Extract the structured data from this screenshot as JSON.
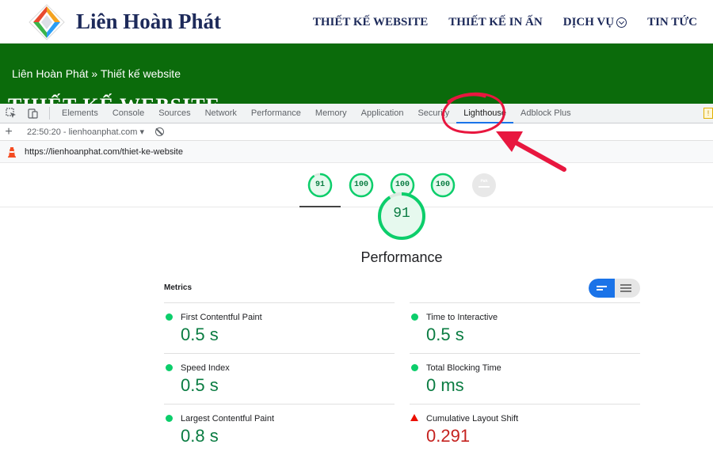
{
  "site": {
    "brand": "Liên Hoàn Phát",
    "nav": [
      {
        "label": "THIẾT KẾ WEBSITE"
      },
      {
        "label": "THIẾT KẾ IN ẤN"
      },
      {
        "label": "DỊCH VỤ",
        "icon": "chevron-down-circle-icon"
      },
      {
        "label": "TIN TỨC"
      }
    ],
    "breadcrumb": "Liên Hoàn Phát  »  Thiết kế website",
    "heading": "THIẾT KẾ WEBSITE",
    "banner_color": "#0b6b0b",
    "text_color": "#1d2a5a"
  },
  "devtools": {
    "tabs": [
      "Elements",
      "Console",
      "Sources",
      "Network",
      "Performance",
      "Memory",
      "Application",
      "Security",
      "Lighthouse",
      "Adblock Plus"
    ],
    "active_tab": "Lighthouse",
    "report": "22:50:20 - lienhoanphat.com",
    "url": "https://lienhoanphat.com/thiet-ke-website"
  },
  "lighthouse": {
    "gauges": [
      {
        "label": "91",
        "score": 91
      },
      {
        "label": "100",
        "score": 100
      },
      {
        "label": "100",
        "score": 100
      },
      {
        "label": "100",
        "score": 100
      },
      {
        "label": "PWA",
        "score": null
      }
    ],
    "performance_score": "91",
    "performance_title": "Performance",
    "metrics_header": "Metrics",
    "metrics_left": [
      {
        "name": "First Contentful Paint",
        "value": "0.5 s",
        "status": "pass"
      },
      {
        "name": "Speed Index",
        "value": "0.5 s",
        "status": "pass"
      },
      {
        "name": "Largest Contentful Paint",
        "value": "0.8 s",
        "status": "pass"
      }
    ],
    "metrics_right": [
      {
        "name": "Time to Interactive",
        "value": "0.5 s",
        "status": "pass"
      },
      {
        "name": "Total Blocking Time",
        "value": "0 ms",
        "status": "pass"
      },
      {
        "name": "Cumulative Layout Shift",
        "value": "0.291",
        "status": "fail"
      }
    ],
    "colors": {
      "pass": "#0cce6b",
      "pass_text": "#0a7c42",
      "fail": "#eb0f00",
      "accent": "#1a73e8"
    }
  }
}
